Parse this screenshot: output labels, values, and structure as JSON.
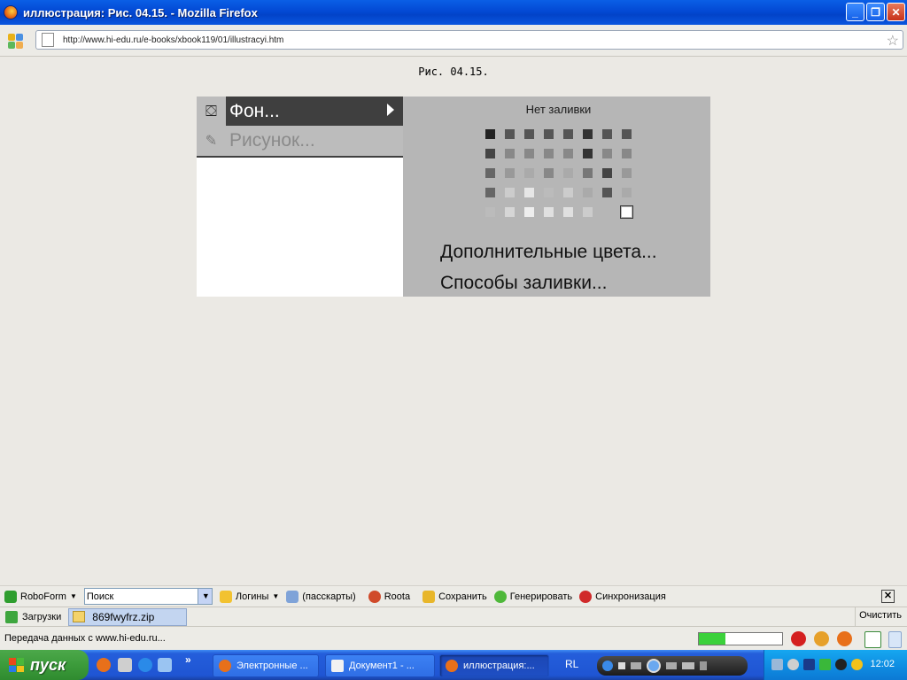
{
  "window": {
    "title": "иллюстрация: Рис. 04.15. - Mozilla Firefox",
    "controls": {
      "minimize": "_",
      "maximize": "❐",
      "close": "✕"
    }
  },
  "navbar": {
    "url": "http://www.hi-edu.ru/e-books/xbook119/01/illustracyi.htm",
    "bookmark_star": "☆"
  },
  "page": {
    "caption": "Рис. 04.15.",
    "menu": {
      "item1_label": "Фон...",
      "item2_label": "Рисунок..."
    },
    "submenu": {
      "no_fill": "Нет заливки",
      "more_colors": "Дополнительные цвета...",
      "fill_effects": "Способы заливки...",
      "swatches": [
        "#222222",
        "#555555",
        "#555555",
        "#555555",
        "#555555",
        "#333333",
        "#555555",
        "#555555",
        "#444444",
        "#888888",
        "#888888",
        "#888888",
        "#888888",
        "#333333",
        "#888888",
        "#888888",
        "#666666",
        "#999999",
        "#aaaaaa",
        "#888888",
        "#aaaaaa",
        "#777777",
        "#444444",
        "#999999",
        "#666666",
        "#cccccc",
        "#e6e6e6",
        "#bbbbbb",
        "#cccccc",
        "#aaaaaa",
        "#555555",
        "#aaaaaa",
        "#bbbbbb",
        "#d6d6d6",
        "#eeeeee",
        "#e0e0e0",
        "#e0e0e0",
        "#cccccc",
        "#b6b6b6",
        "#ffffff"
      ]
    }
  },
  "roboform_toolbar": {
    "brand": "RoboForm",
    "search_value": "Поиск",
    "logins": "Логины",
    "passcards": "(пасскарты)",
    "roota": "Roota",
    "save": "Сохранить",
    "generate": "Генерировать",
    "sync": "Синхронизация",
    "close": "✕"
  },
  "downloads": {
    "label": "Загрузки",
    "file": "869fwyfrz.zip",
    "clear": "Очистить"
  },
  "status": {
    "text": "Передача данных с www.hi-edu.ru...",
    "progress_percent": 32
  },
  "taskbar": {
    "start_label": "пуск",
    "more": "»",
    "tasks": [
      {
        "label": "Электронные ..."
      },
      {
        "label": "Документ1 - ..."
      },
      {
        "label": "иллюстрация:..."
      }
    ],
    "language": "RL",
    "clock": "12:02"
  },
  "colors": {
    "title_bar": "#0349d4",
    "menu_highlight": "#3f3f3f",
    "submenu_bg": "#b6b6b6",
    "progress_fill": "#3bd13b",
    "start_green": "#3c9b3b"
  }
}
